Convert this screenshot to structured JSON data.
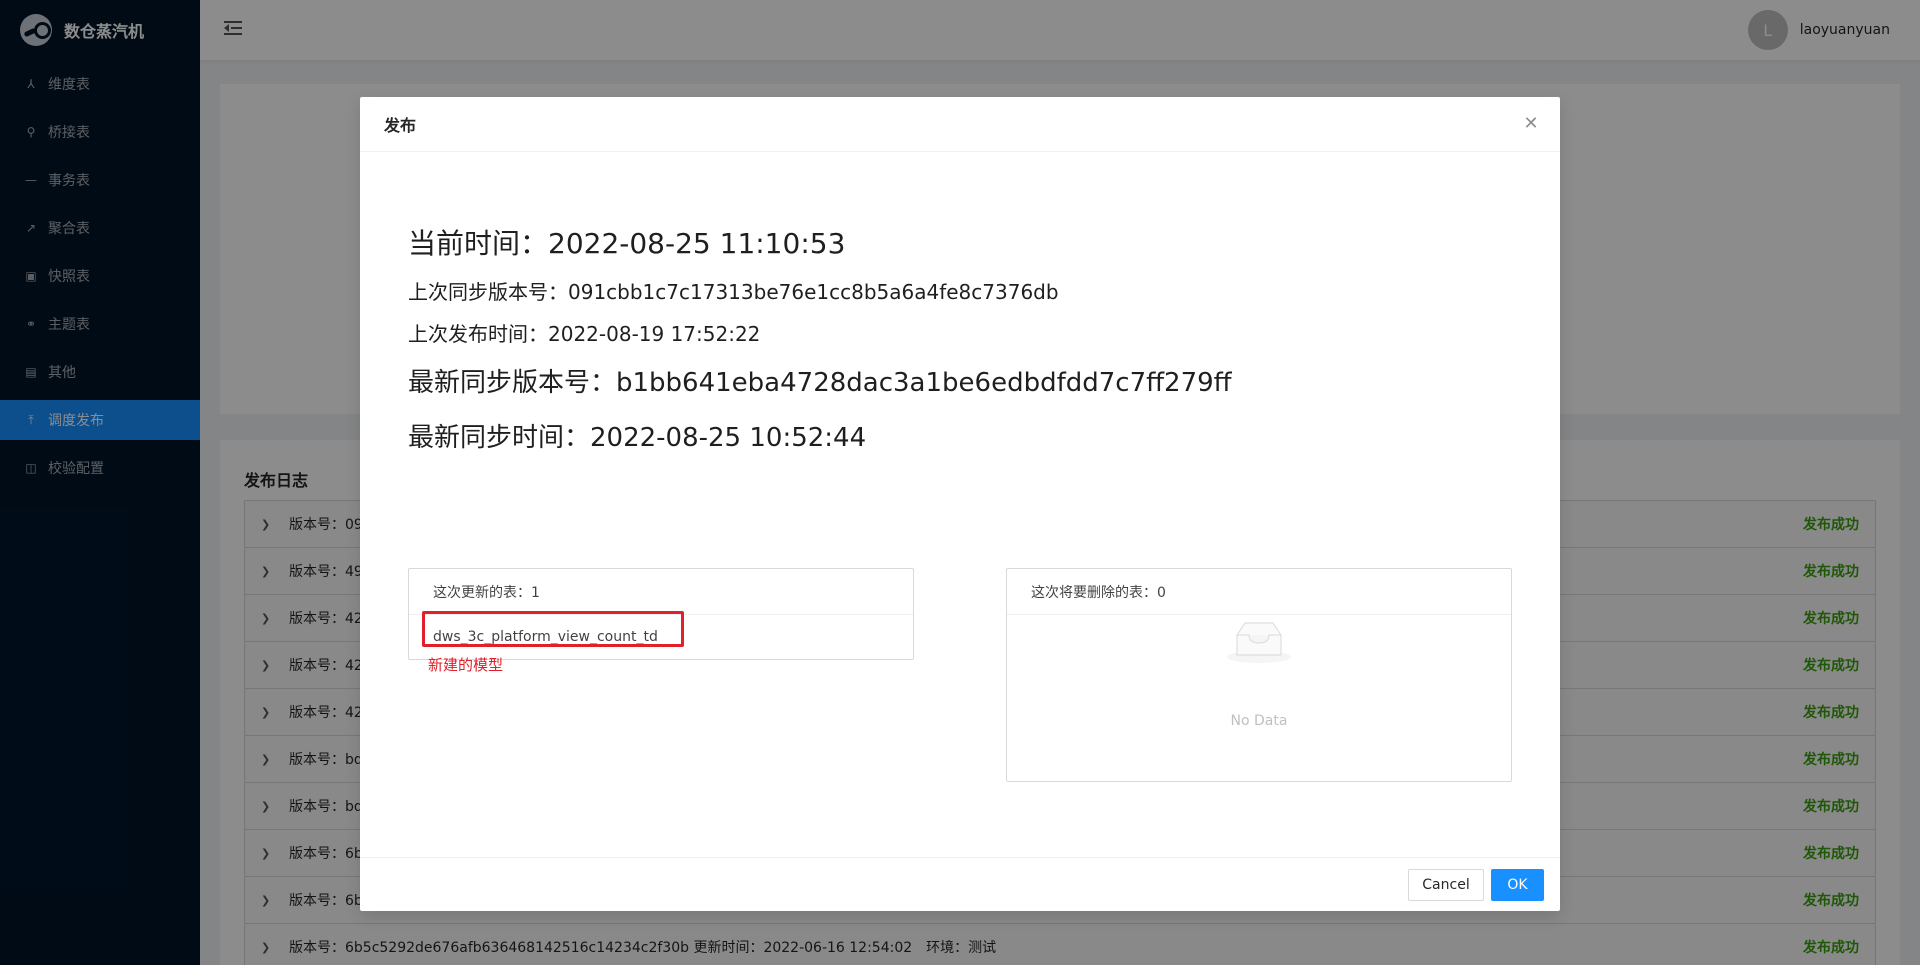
{
  "app": {
    "title": "数仓蒸汽机",
    "logo_icon": "steam-logo-icon"
  },
  "sidebar": {
    "items": [
      {
        "label": "维度表",
        "icon": "dimension-icon",
        "glyph": "⅄",
        "active": false
      },
      {
        "label": "桥接表",
        "icon": "link-icon",
        "glyph": "⚲",
        "active": false
      },
      {
        "label": "事务表",
        "icon": "minus-icon",
        "glyph": "—",
        "active": false
      },
      {
        "label": "聚合表",
        "icon": "line-chart-icon",
        "glyph": "↗",
        "active": false
      },
      {
        "label": "快照表",
        "icon": "picture-icon",
        "glyph": "▣",
        "active": false
      },
      {
        "label": "主题表",
        "icon": "link-icon",
        "glyph": "⚭",
        "active": false
      },
      {
        "label": "其他",
        "icon": "id-card-icon",
        "glyph": "▤",
        "active": false
      },
      {
        "label": "调度发布",
        "icon": "upload-icon",
        "glyph": "⤒",
        "active": true
      },
      {
        "label": "校验配置",
        "icon": "stock-icon",
        "glyph": "◫",
        "active": false
      }
    ]
  },
  "header": {
    "user": {
      "avatar_letter": "L",
      "name": "laoyuanyuan"
    }
  },
  "log": {
    "title": "发布日志",
    "rows": [
      {
        "text": "版本号：09",
        "status": "发布成功"
      },
      {
        "text": "版本号：49",
        "status": "发布成功"
      },
      {
        "text": "版本号：42",
        "status": "发布成功"
      },
      {
        "text": "版本号：42",
        "status": "发布成功"
      },
      {
        "text": "版本号：42",
        "status": "发布成功"
      },
      {
        "text": "版本号：bd",
        "status": "发布成功"
      },
      {
        "text": "版本号：bd",
        "status": "发布成功"
      },
      {
        "text": "版本号：6b",
        "status": "发布成功"
      },
      {
        "text": "版本号：6b",
        "status": "发布成功"
      },
      {
        "text": "版本号：6b5c5292de676afb636468142516c14234c2f30b 更新时间：2022-06-16 12:54:02　环境：测试",
        "status": "发布成功"
      }
    ]
  },
  "modal": {
    "title": "发布",
    "close_icon": "close-icon",
    "current_time": "当前时间：2022-08-25 11:10:53",
    "last_sync_version": "上次同步版本号：091cbb1c7c17313be76e1cc8b5a6a4fe8c7376db",
    "last_publish_time": "上次发布时间：2022-08-19 17:52:22",
    "latest_sync_version": "最新同步版本号：b1bb641eba4728dac3a1be6edbdfdd7c7ff279ff",
    "latest_sync_time": "最新同步时间：2022-08-25 10:52:44",
    "updated_tables": {
      "header": "这次更新的表：1",
      "items": [
        "dws_3c_platform_view_count_td"
      ]
    },
    "new_model_note": "新建的模型",
    "deleted_tables": {
      "header": "这次将要删除的表：0",
      "empty_text": "No Data",
      "empty_icon": "inbox-empty-icon"
    },
    "cancel_label": "Cancel",
    "ok_label": "OK"
  }
}
